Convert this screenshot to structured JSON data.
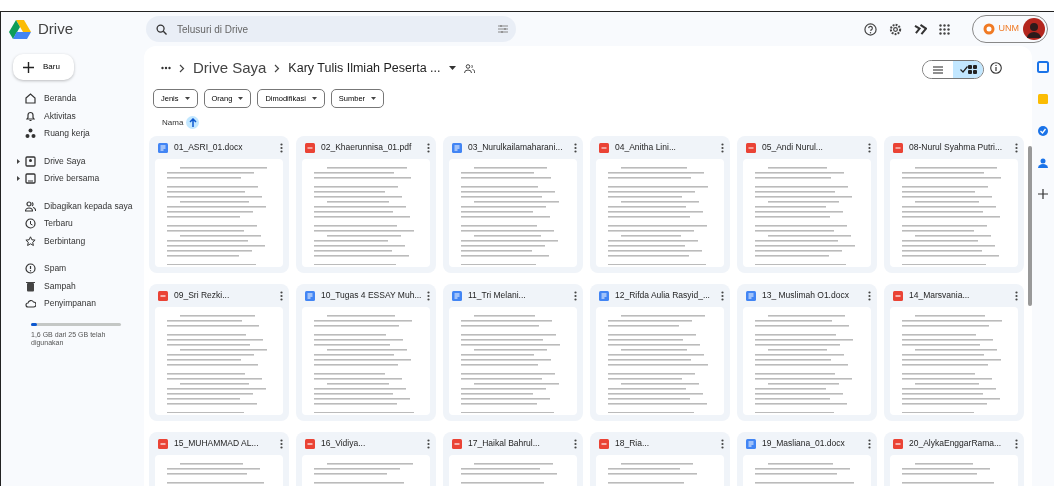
{
  "app": {
    "name": "Drive"
  },
  "search": {
    "placeholder": "Telusuri di Drive"
  },
  "account": {
    "org": "UNM"
  },
  "new_button": {
    "label": "Baru"
  },
  "sidebar": {
    "groups": [
      [
        {
          "kind": "home",
          "label": "Beranda",
          "expandable": false
        },
        {
          "kind": "bell",
          "label": "Aktivitas",
          "expandable": false
        },
        {
          "kind": "workspace",
          "label": "Ruang kerja",
          "expandable": false
        }
      ],
      [
        {
          "kind": "mydrive",
          "label": "Drive Saya",
          "expandable": true
        },
        {
          "kind": "shareddrive",
          "label": "Drive bersama",
          "expandable": true
        }
      ],
      [
        {
          "kind": "people",
          "label": "Dibagikan kepada saya",
          "expandable": false
        },
        {
          "kind": "clock",
          "label": "Terbaru",
          "expandable": false
        },
        {
          "kind": "star",
          "label": "Berbintang",
          "expandable": false
        }
      ],
      [
        {
          "kind": "spam",
          "label": "Spam",
          "expandable": false
        },
        {
          "kind": "trash",
          "label": "Sampah",
          "expandable": false
        },
        {
          "kind": "cloud",
          "label": "Penyimpanan",
          "expandable": false
        }
      ]
    ]
  },
  "storage": {
    "level": 0.064,
    "text": "1,6 GB dari 25 GB telah digunakan"
  },
  "breadcrumb": {
    "items": [
      "Drive Saya",
      "Kary Tulis Ilmiah Peserta ..."
    ]
  },
  "filters": [
    "Jenis",
    "Orang",
    "Dimodifikasi",
    "Sumber"
  ],
  "sort": {
    "label": "Nama",
    "ascending": true
  },
  "view_modes": [
    {
      "kind": "list",
      "selected": false
    },
    {
      "kind": "grid",
      "selected": true
    }
  ],
  "files": [
    {
      "name": "01_ASRI_01.docx",
      "kind": "doc"
    },
    {
      "name": "02_Khaerunnisa_01.pdf",
      "kind": "pdf"
    },
    {
      "name": "03_Nurulkailamaharani...",
      "kind": "doc"
    },
    {
      "name": "04_Anitha Lini...",
      "kind": "pdf"
    },
    {
      "name": "05_Andi Nurul...",
      "kind": "pdf"
    },
    {
      "name": "08-Nurul Syahma Putri...",
      "kind": "pdf"
    },
    {
      "name": "09_Sri Rezki...",
      "kind": "pdf"
    },
    {
      "name": "10_Tugas 4 ESSAY Muh...",
      "kind": "doc"
    },
    {
      "name": "11_Tri Melani...",
      "kind": "doc"
    },
    {
      "name": "12_Rifda Aulia Rasyid_...",
      "kind": "doc"
    },
    {
      "name": "13_ Muslimah O1.docx",
      "kind": "doc"
    },
    {
      "name": "14_Marsvania...",
      "kind": "pdf"
    },
    {
      "name": "15_MUHAMMAD AL...",
      "kind": "pdf"
    },
    {
      "name": "16_Vidiya...",
      "kind": "pdf"
    },
    {
      "name": "17_Haikal Bahrul...",
      "kind": "pdf"
    },
    {
      "name": "18_Ria...",
      "kind": "pdf"
    },
    {
      "name": "19_Masliana_01.docx",
      "kind": "doc"
    },
    {
      "name": "20_AlykaEnggarRama...",
      "kind": "pdf"
    }
  ]
}
